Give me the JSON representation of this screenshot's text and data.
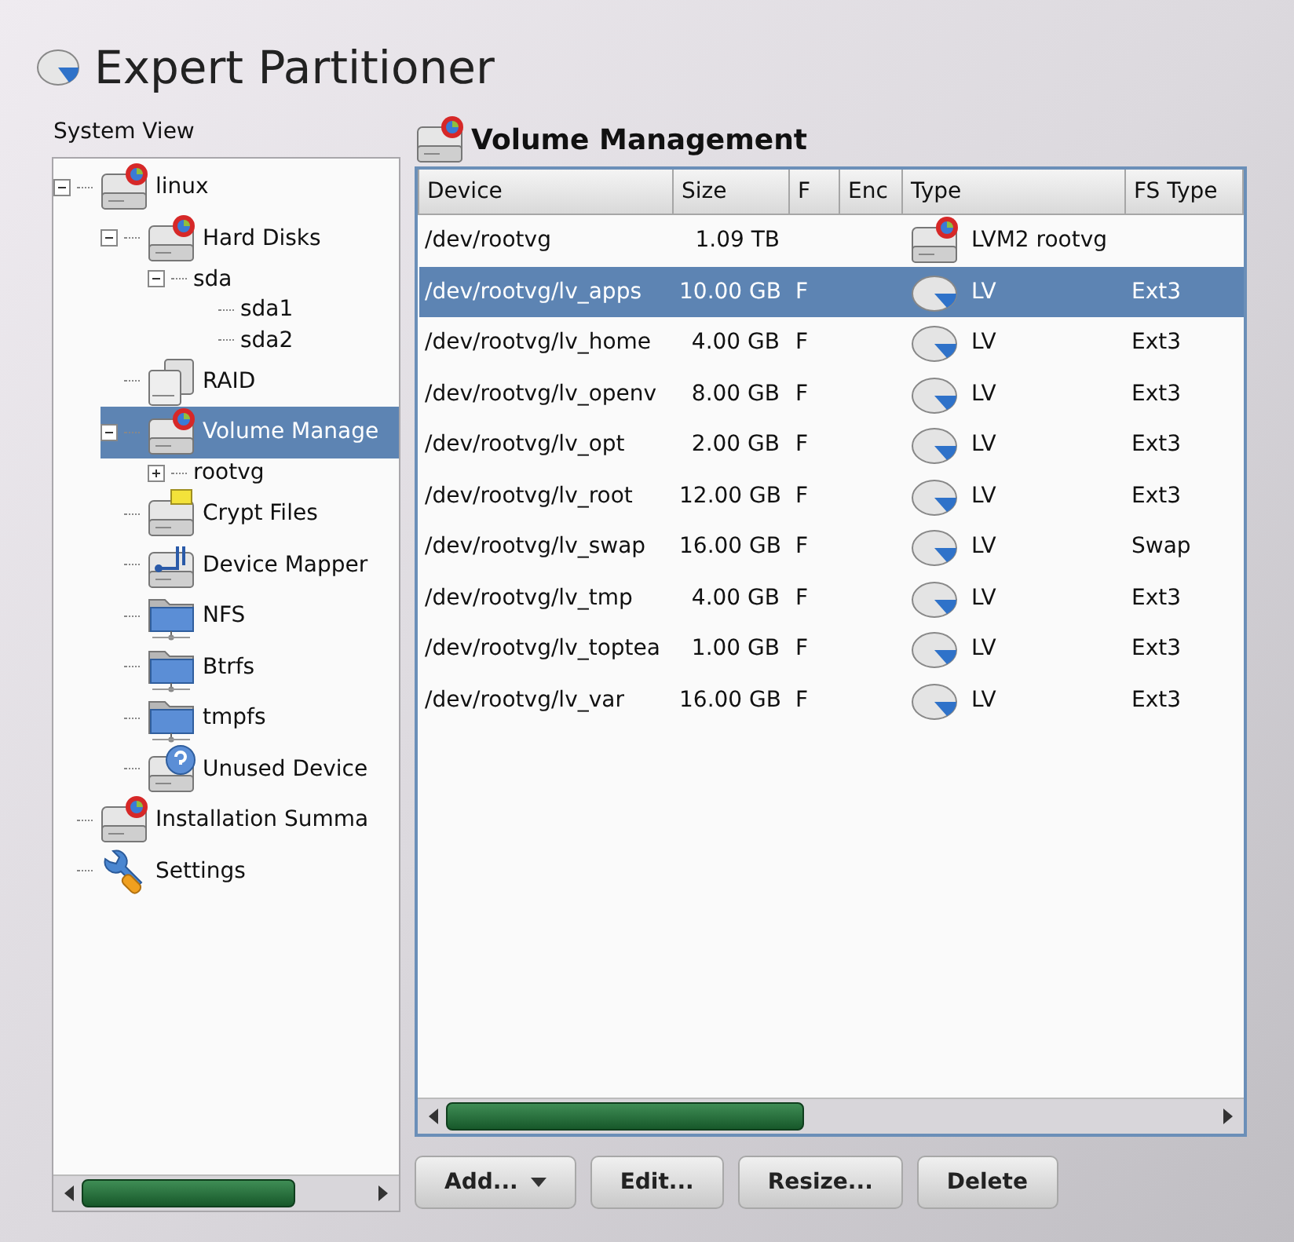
{
  "window": {
    "title": "Expert Partitioner"
  },
  "system_view": {
    "label": "System View",
    "tree": [
      {
        "label": "linux",
        "kind": "disk",
        "expanded": true,
        "selected": false,
        "children": [
          {
            "label": "Hard Disks",
            "kind": "disk",
            "expanded": true,
            "selected": false,
            "children": [
              {
                "label": "sda",
                "kind": "none",
                "expanded": true,
                "selected": false,
                "children": [
                  {
                    "label": "sda1",
                    "kind": "none",
                    "selected": false
                  },
                  {
                    "label": "sda2",
                    "kind": "none",
                    "selected": false
                  }
                ]
              }
            ]
          },
          {
            "label": "RAID",
            "kind": "raid",
            "selected": false
          },
          {
            "label": "Volume Manage",
            "kind": "disk",
            "expanded": true,
            "selected": true,
            "children": [
              {
                "label": "rootvg",
                "kind": "none",
                "expanded": false,
                "selected": false
              }
            ]
          },
          {
            "label": "Crypt Files",
            "kind": "crypt",
            "selected": false
          },
          {
            "label": "Device Mapper",
            "kind": "mapper",
            "selected": false
          },
          {
            "label": "NFS",
            "kind": "folder",
            "selected": false
          },
          {
            "label": "Btrfs",
            "kind": "folder",
            "selected": false
          },
          {
            "label": "tmpfs",
            "kind": "folder",
            "selected": false
          },
          {
            "label": "Unused Device",
            "kind": "unused",
            "selected": false
          }
        ]
      },
      {
        "label": "Installation Summa",
        "kind": "disk",
        "selected": false
      },
      {
        "label": "Settings",
        "kind": "settings",
        "selected": false
      }
    ]
  },
  "panel": {
    "title": "Volume Management",
    "table": {
      "columns": [
        "Device",
        "Size",
        "F",
        "Enc",
        "Type",
        "FS Type"
      ],
      "rows": [
        {
          "device": "/dev/rootvg",
          "size": "1.09 TB",
          "f": "",
          "kind": "vg",
          "type": "LVM2 rootvg",
          "fs_type": "",
          "selected": false
        },
        {
          "device": "/dev/rootvg/lv_apps",
          "size": "10.00 GB",
          "f": "F",
          "kind": "lv",
          "type": "LV",
          "fs_type": "Ext3",
          "selected": true
        },
        {
          "device": "/dev/rootvg/lv_home",
          "size": "4.00 GB",
          "f": "F",
          "kind": "lv",
          "type": "LV",
          "fs_type": "Ext3",
          "selected": false
        },
        {
          "device": "/dev/rootvg/lv_openv",
          "size": "8.00 GB",
          "f": "F",
          "kind": "lv",
          "type": "LV",
          "fs_type": "Ext3",
          "selected": false
        },
        {
          "device": "/dev/rootvg/lv_opt",
          "size": "2.00 GB",
          "f": "F",
          "kind": "lv",
          "type": "LV",
          "fs_type": "Ext3",
          "selected": false
        },
        {
          "device": "/dev/rootvg/lv_root",
          "size": "12.00 GB",
          "f": "F",
          "kind": "lv",
          "type": "LV",
          "fs_type": "Ext3",
          "selected": false
        },
        {
          "device": "/dev/rootvg/lv_swap",
          "size": "16.00 GB",
          "f": "F",
          "kind": "lv",
          "type": "LV",
          "fs_type": "Swap",
          "selected": false
        },
        {
          "device": "/dev/rootvg/lv_tmp",
          "size": "4.00 GB",
          "f": "F",
          "kind": "lv",
          "type": "LV",
          "fs_type": "Ext3",
          "selected": false
        },
        {
          "device": "/dev/rootvg/lv_toptea",
          "size": "1.00 GB",
          "f": "F",
          "kind": "lv",
          "type": "LV",
          "fs_type": "Ext3",
          "selected": false
        },
        {
          "device": "/dev/rootvg/lv_var",
          "size": "16.00 GB",
          "f": "F",
          "kind": "lv",
          "type": "LV",
          "fs_type": "Ext3",
          "selected": false
        }
      ]
    },
    "buttons": [
      {
        "label": "Add...",
        "menu": true
      },
      {
        "label": "Edit...",
        "menu": false
      },
      {
        "label": "Resize...",
        "menu": false
      },
      {
        "label": "Delete",
        "menu": false
      }
    ]
  }
}
